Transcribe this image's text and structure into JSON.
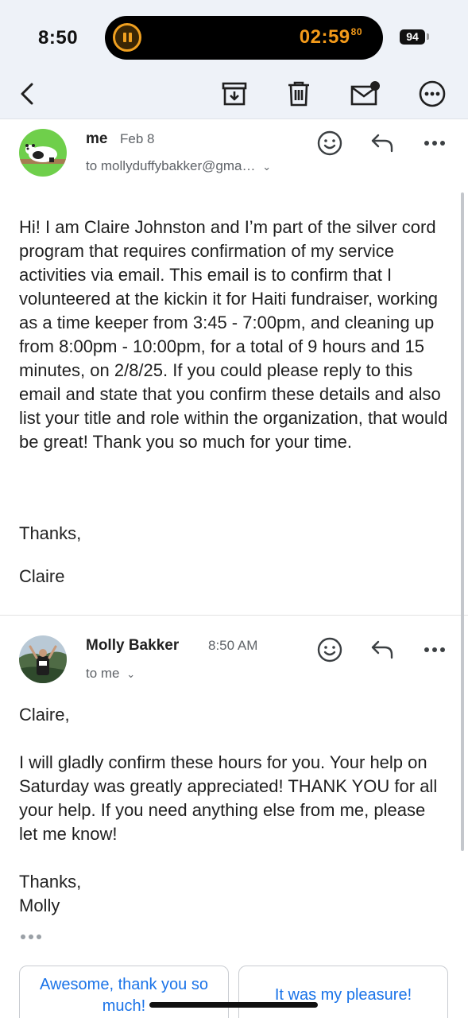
{
  "status_bar": {
    "time": "8:50",
    "live_activity_timer": "02:59",
    "live_activity_timer_fraction": "80",
    "battery": "94"
  },
  "toolbar": {
    "icons": [
      "back-icon",
      "archive-icon",
      "delete-icon",
      "mark-unread-icon",
      "more-icon"
    ]
  },
  "messages": [
    {
      "sender": "me",
      "date": "Feb 8",
      "recipient": "to mollyduffybakker@gma…",
      "body": "Hi! I am Claire Johnston and I’m part of the silver cord program that requires confirmation of my service activities via email. This email is to confirm that I volunteered at the kickin it for Haiti fundraiser, working as a time keeper from 3:45 - 7:00pm, and cleaning up from 8:00pm - 10:00pm, for a total of 9 hours and 15 minutes, on 2/8/25. If you could please reply to this email and state that you confirm these details and also list your title and role within the organization, that would be great! Thank you so much for your time.",
      "signoff": "Thanks,",
      "signature": "Claire"
    },
    {
      "sender": "Molly Bakker",
      "date": "8:50 AM",
      "recipient": "to me",
      "greeting": "Claire,",
      "body": "I will gladly confirm these hours for you.  Your help on Saturday was greatly appreciated! THANK YOU for all your help.  If you need anything else from me, please let me know!",
      "signoff": "Thanks,",
      "signature": "Molly"
    }
  ],
  "smart_replies": [
    "Awesome, thank you so much!",
    "It was my pleasure!"
  ],
  "colors": {
    "toolbar_bg": "#eef2f8",
    "accent": "#1a73e8",
    "timer": "#f39a1a"
  }
}
